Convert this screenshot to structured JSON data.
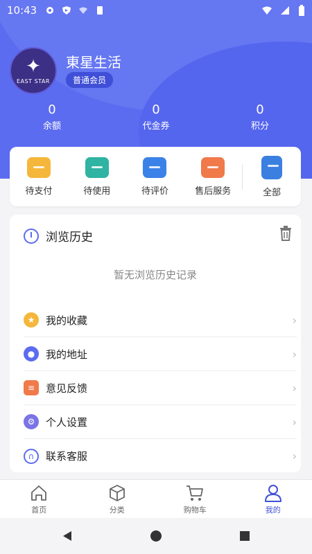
{
  "status_bar": {
    "time": "10:43"
  },
  "profile": {
    "brand_text": "EAST STAR",
    "name": "東星生活",
    "level": "普通会员"
  },
  "stats": [
    {
      "value": "0",
      "label": "余额"
    },
    {
      "value": "0",
      "label": "代金券"
    },
    {
      "value": "0",
      "label": "积分"
    }
  ],
  "orders": [
    {
      "label": "待支付",
      "color": "#f4b73b"
    },
    {
      "label": "待使用",
      "color": "#2fb3a2"
    },
    {
      "label": "待评价",
      "color": "#3b82e8"
    },
    {
      "label": "售后服务",
      "color": "#f07a4a"
    },
    {
      "label": "全部",
      "color": "#3b7fe0"
    }
  ],
  "history": {
    "title": "浏览历史",
    "empty_text": "暂无浏览历史记录"
  },
  "menu": [
    {
      "label": "我的收藏",
      "icon": "star-icon",
      "color": "#f4b73b"
    },
    {
      "label": "我的地址",
      "icon": "location-icon",
      "color": "#5b6cf0"
    },
    {
      "label": "意见反馈",
      "icon": "feedback-icon",
      "color": "#f07a4a"
    },
    {
      "label": "个人设置",
      "icon": "gear-icon",
      "color": "#7b74e6"
    },
    {
      "label": "联系客服",
      "icon": "headset-icon",
      "color": "#5b6cf0"
    }
  ],
  "tabbar": [
    {
      "label": "首页",
      "icon": "home-icon"
    },
    {
      "label": "分类",
      "icon": "category-icon"
    },
    {
      "label": "购物车",
      "icon": "cart-icon"
    },
    {
      "label": "我的",
      "icon": "profile-icon",
      "active": true
    }
  ],
  "colors": {
    "accent": "#5b6cf0",
    "badge": "#3f4fd8"
  }
}
